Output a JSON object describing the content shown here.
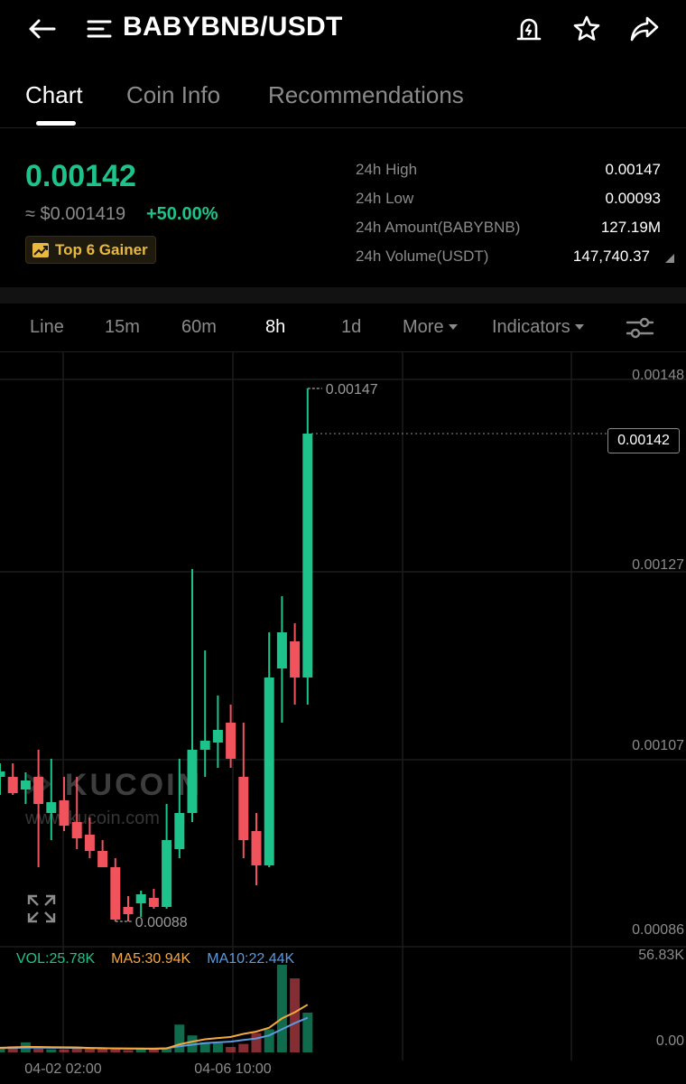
{
  "header": {
    "title": "BABYBNB/USDT",
    "icons": [
      "back-arrow-icon",
      "menu-icon",
      "price-alert-icon",
      "star-icon",
      "share-icon"
    ]
  },
  "tabs": [
    {
      "label": "Chart",
      "active": true
    },
    {
      "label": "Coin Info",
      "active": false
    },
    {
      "label": "Recommendations",
      "active": false
    }
  ],
  "ticker": {
    "last_price": "0.00142",
    "usd_price": "≈ $0.001419",
    "change": "+50.00%",
    "badge": "Top 6 Gainer"
  },
  "stats": [
    {
      "label": "24h High",
      "value": "0.00147"
    },
    {
      "label": "24h Low",
      "value": "0.00093"
    },
    {
      "label": "24h Amount(BABYBNB)",
      "value": "127.19M"
    },
    {
      "label": "24h Volume(USDT)",
      "value": "147,740.37"
    }
  ],
  "intervals": [
    {
      "label": "Line",
      "active": false
    },
    {
      "label": "15m",
      "active": false
    },
    {
      "label": "60m",
      "active": false
    },
    {
      "label": "8h",
      "active": true
    },
    {
      "label": "1d",
      "active": false
    },
    {
      "label": "More",
      "active": false
    },
    {
      "label": "Indicators",
      "active": false
    }
  ],
  "colors": {
    "up": "#1dc38b",
    "down": "#f0535c",
    "ma5": "#f5a740",
    "ma10": "#5b9bdf",
    "badge": "#e9b93f"
  },
  "chart_data": {
    "type": "candlestick",
    "y_axis_labels": [
      "0.00148",
      "0.00127",
      "0.00107",
      "0.00086"
    ],
    "y_axis_values": [
      0.00148,
      0.00127,
      0.00107,
      0.00086
    ],
    "current_price_label": "0.00142",
    "current_price": 0.00142,
    "high_marker_label": "0.00147",
    "high_marker": 0.00147,
    "low_marker_label": "0.00088",
    "low_marker": 0.00088,
    "x_axis_labels": [
      "04-02 02:00",
      "04-06 10:00"
    ],
    "watermark": "KUCOIN",
    "watermark_url": "www.kucoin.com",
    "candles": [
      {
        "o": 0.00104,
        "h": 0.001055,
        "l": 0.00102,
        "c": 0.001046
      },
      {
        "o": 0.00104,
        "h": 0.001055,
        "l": 0.00102,
        "c": 0.001022
      },
      {
        "o": 0.001026,
        "h": 0.001045,
        "l": 0.00101,
        "c": 0.001036
      },
      {
        "o": 0.00104,
        "h": 0.00107,
        "l": 0.00094,
        "c": 0.00101
      },
      {
        "o": 0.001,
        "h": 0.00106,
        "l": 0.00097,
        "c": 0.001012
      },
      {
        "o": 0.001014,
        "h": 0.00104,
        "l": 0.00098,
        "c": 0.000986
      },
      {
        "o": 0.00099,
        "h": 0.00104,
        "l": 0.00096,
        "c": 0.000972
      },
      {
        "o": 0.000976,
        "h": 0.000995,
        "l": 0.00095,
        "c": 0.000958
      },
      {
        "o": 0.000958,
        "h": 0.00097,
        "l": 0.00094,
        "c": 0.00094
      },
      {
        "o": 0.00094,
        "h": 0.00095,
        "l": 0.00088,
        "c": 0.000882
      },
      {
        "o": 0.000896,
        "h": 0.000908,
        "l": 0.00088,
        "c": 0.000888
      },
      {
        "o": 0.0009,
        "h": 0.000914,
        "l": 0.000885,
        "c": 0.00091
      },
      {
        "o": 0.000906,
        "h": 0.000916,
        "l": 0.000894,
        "c": 0.000896
      },
      {
        "o": 0.000896,
        "h": 0.00101,
        "l": 0.000894,
        "c": 0.00097
      },
      {
        "o": 0.00096,
        "h": 0.00106,
        "l": 0.00095,
        "c": 0.001
      },
      {
        "o": 0.001,
        "h": 0.00127,
        "l": 0.00099,
        "c": 0.00107
      },
      {
        "o": 0.00107,
        "h": 0.00118,
        "l": 0.00104,
        "c": 0.00108
      },
      {
        "o": 0.001078,
        "h": 0.00113,
        "l": 0.00105,
        "c": 0.001092
      },
      {
        "o": 0.0011,
        "h": 0.00112,
        "l": 0.00105,
        "c": 0.00106
      },
      {
        "o": 0.00104,
        "h": 0.0011,
        "l": 0.00095,
        "c": 0.00097
      },
      {
        "o": 0.00098,
        "h": 0.001,
        "l": 0.00092,
        "c": 0.000942
      },
      {
        "o": 0.000942,
        "h": 0.0012,
        "l": 0.00094,
        "c": 0.00115
      },
      {
        "o": 0.00116,
        "h": 0.00124,
        "l": 0.0011,
        "c": 0.0012
      },
      {
        "o": 0.00119,
        "h": 0.00121,
        "l": 0.00112,
        "c": 0.00115
      },
      {
        "o": 0.00115,
        "h": 0.00147,
        "l": 0.00112,
        "c": 0.00142
      }
    ],
    "volume": {
      "label": "VOL:25.78K",
      "ma5_label": "MA5:30.94K",
      "ma10_label": "MA10:22.44K",
      "axis_max_label": "56.83K",
      "axis_min_label": "0.00",
      "axis_max": 56830,
      "values": [
        2500,
        4000,
        6500,
        2500,
        2000,
        2000,
        2500,
        3000,
        2500,
        2000,
        1500,
        2500,
        2000,
        2500,
        18000,
        11000,
        6500,
        6000,
        3500,
        5500,
        12500,
        15000,
        56830,
        48000,
        25780
      ],
      "ma5": [
        3000,
        3200,
        3600,
        3500,
        3400,
        3300,
        3200,
        2900,
        2700,
        2600,
        2500,
        2400,
        2300,
        2600,
        5200,
        7000,
        8500,
        9300,
        10000,
        12000,
        13500,
        16000,
        22000,
        26000,
        30940
      ],
      "ma10": [
        2800,
        2900,
        3100,
        3100,
        3000,
        3000,
        2900,
        2800,
        2700,
        2600,
        2500,
        2500,
        2500,
        2700,
        4000,
        5000,
        6000,
        6500,
        7000,
        8000,
        9000,
        11000,
        15000,
        19000,
        22440
      ]
    }
  }
}
